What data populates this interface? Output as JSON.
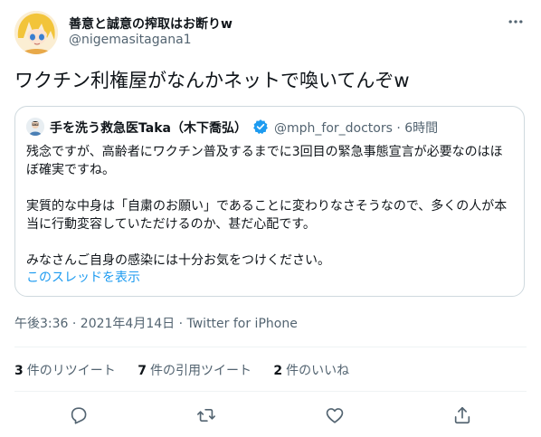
{
  "tweet": {
    "display_name": "善意と誠意の搾取はお断りw",
    "handle": "@nigemasitagana1",
    "text": "ワクチン利権屋がなんかネットで喚いてんぞw",
    "timestamp": "午後3:36 · 2021年4月14日 · Twitter for iPhone"
  },
  "quote": {
    "name": "手を洗う救急医Taka（木下喬弘）",
    "meta": "@mph_for_doctors · 6時間",
    "paragraphs": [
      "残念ですが、高齢者にワクチン普及するまでに3回目の緊急事態宣言が必要なのはほぼ確実ですね。",
      "実質的な中身は「自粛のお願い」であることに変わりなさそうなので、多くの人が本当に行動変容していただけるのか、甚だ心配です。",
      "みなさんご自身の感染には十分お気をつけください。"
    ],
    "show_thread": "このスレッドを表示"
  },
  "stats": {
    "retweets_count": "3",
    "retweets_label": "件のリツイート",
    "quotes_count": "7",
    "quotes_label": "件の引用ツイート",
    "likes_count": "2",
    "likes_label": "件のいいね"
  },
  "icons": {
    "more": "more-icon",
    "verified": "verified-badge-icon",
    "reply": "reply-icon",
    "retweet": "retweet-icon",
    "like": "like-icon",
    "share": "share-icon"
  },
  "colors": {
    "link": "#1d9bf0",
    "text": "#0f1419",
    "secondary": "#536471",
    "border": "#cfd9de"
  }
}
